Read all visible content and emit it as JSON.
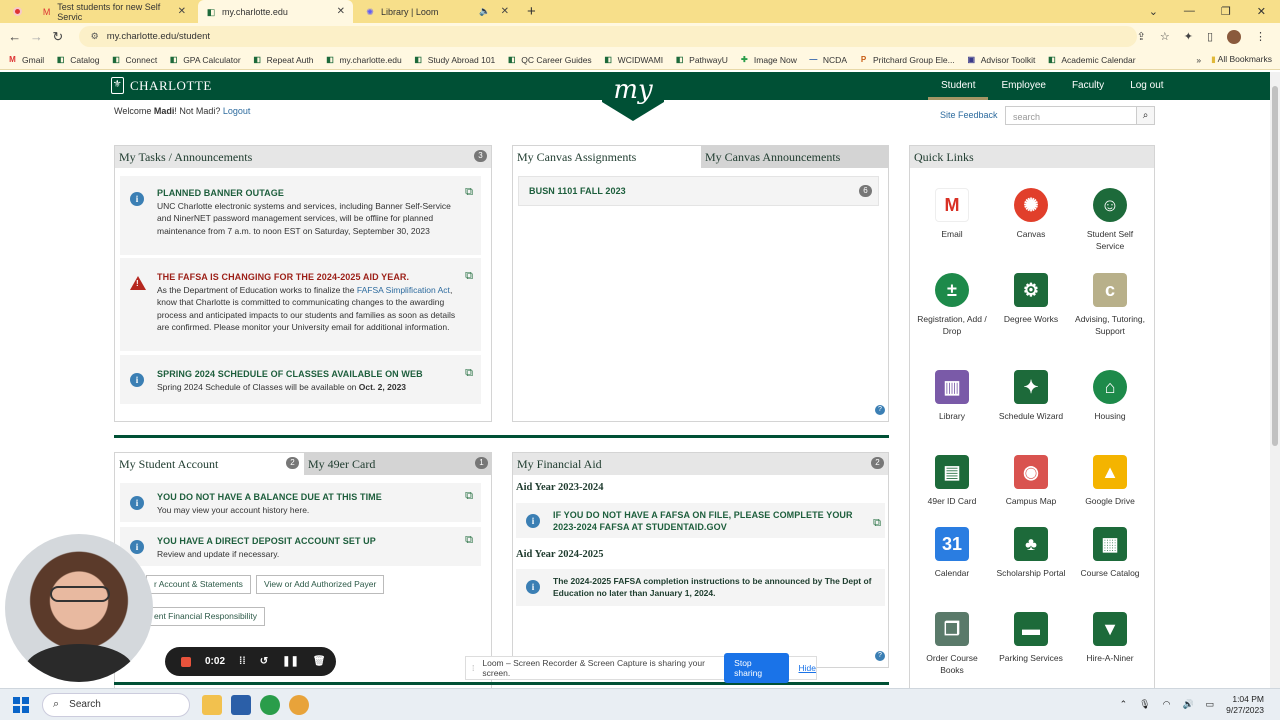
{
  "browser": {
    "tabs": [
      {
        "title": "Test students for new Self Servic",
        "active": false
      },
      {
        "title": "my.charlotte.edu",
        "active": true
      },
      {
        "title": "Library | Loom",
        "active": false
      }
    ],
    "url": "my.charlotte.edu/student",
    "bookmarks": [
      "Gmail",
      "Catalog",
      "Connect",
      "GPA Calculator",
      "Repeat Auth",
      "my.charlotte.edu",
      "Study Abroad 101",
      "QC Career Guides",
      "WCIDWAMI",
      "PathwayU",
      "Image Now",
      "NCDA",
      "Pritchard Group Ele...",
      "Advisor Toolkit",
      "Academic Calendar"
    ],
    "all_bookmarks": "All Bookmarks"
  },
  "header": {
    "logo_text": "CHARLOTTE",
    "badge_text": "my",
    "nav": [
      "Student",
      "Employee",
      "Faculty",
      "Log out"
    ]
  },
  "welcome": {
    "prefix": "Welcome ",
    "name": "Madi",
    "middle": "! Not Madi? ",
    "logout": "Logout"
  },
  "site_feedback": "Site Feedback",
  "search_placeholder": "search",
  "tasks": {
    "title": "My Tasks / Announcements",
    "count": "3",
    "items": [
      {
        "title": "PLANNED BANNER OUTAGE",
        "body": "UNC Charlotte electronic systems and services, including Banner Self-Service and NinerNET password management services, will be offline for planned maintenance from 7 a.m. to noon EST on Saturday, September 30, 2023"
      },
      {
        "title": "THE FAFSA IS CHANGING FOR THE 2024-2025 AID YEAR.",
        "body_a": "As the Department of Education works to finalize the ",
        "body_link": "FAFSA Simplification Act",
        "body_b": ", know that Charlotte is committed to communicating changes to the awarding process and anticipated impacts to our students and families as soon as details are confirmed. Please monitor your University email for additional information."
      },
      {
        "title": "SPRING 2024 SCHEDULE OF CLASSES AVAILABLE ON WEB",
        "body_a": "Spring 2024 Schedule of Classes will be available on ",
        "body_bold": "Oct. 2, 2023"
      }
    ]
  },
  "canvas": {
    "tab1": "My Canvas Assignments",
    "tab2": "My Canvas Announcements",
    "course": "BUSN 1101 FALL 2023",
    "course_count": "6"
  },
  "student_account": {
    "tab1": "My Student Account",
    "count1": "2",
    "tab2": "My 49er Card",
    "count2": "1",
    "items": [
      {
        "title": "YOU DO NOT HAVE A BALANCE DUE AT THIS TIME",
        "body": "You may view your account history here."
      },
      {
        "title": "YOU HAVE A DIRECT DEPOSIT ACCOUNT SET UP",
        "body": "Review and update if necessary."
      }
    ],
    "btn1": "r Account & Statements",
    "btn2": "View or Add Authorized Payer",
    "btn3": "ent Financial Responsibility"
  },
  "financial_aid": {
    "title": "My Financial Aid",
    "count": "2",
    "year1": "Aid Year 2023-2024",
    "item1": "IF YOU DO NOT HAVE A FAFSA ON FILE, PLEASE COMPLETE YOUR 2023-2024 FAFSA AT STUDENTAID.GOV",
    "year2": "Aid Year 2024-2025",
    "item2": "The 2024-2025 FAFSA completion instructions to be announced by The Dept of Education no later than January 1, 2024."
  },
  "quick_links": {
    "title": "Quick Links",
    "links": [
      {
        "label": "Email",
        "icon": "gmail-icon",
        "color": "#ffffff"
      },
      {
        "label": "Canvas",
        "icon": "canvas-icon",
        "color": "#e13f2b"
      },
      {
        "label": "Student Self Service",
        "icon": "self-service-icon",
        "color": "#1d6a3a"
      },
      {
        "label": "Registration, Add / Drop",
        "icon": "registration-icon",
        "color": "#1d8a4a"
      },
      {
        "label": "Degree Works",
        "icon": "gear-icon",
        "color": "#1d6a3a"
      },
      {
        "label": "Advising, Tutoring, Support",
        "icon": "connect-icon",
        "color": "#b8b08a"
      },
      {
        "label": "Library",
        "icon": "books-icon",
        "color": "#7a5aa8"
      },
      {
        "label": "Schedule Wizard",
        "icon": "wizard-icon",
        "color": "#1d6a3a"
      },
      {
        "label": "Housing",
        "icon": "housing-icon",
        "color": "#1d8a4a"
      },
      {
        "label": "49er ID Card",
        "icon": "id-card-icon",
        "color": "#1d6a3a"
      },
      {
        "label": "Campus Map",
        "icon": "map-icon",
        "color": "#d9534f"
      },
      {
        "label": "Google Drive",
        "icon": "drive-icon",
        "color": "#f4b400"
      },
      {
        "label": "Calendar",
        "icon": "calendar-icon",
        "color": "#2a7de1"
      },
      {
        "label": "Scholarship Portal",
        "icon": "tree-icon",
        "color": "#1d6a3a"
      },
      {
        "label": "Course Catalog",
        "icon": "catalog-icon",
        "color": "#1d6a3a"
      },
      {
        "label": "Order Course Books",
        "icon": "books-order-icon",
        "color": "#5a7a6a"
      },
      {
        "label": "Parking Services",
        "icon": "car-icon",
        "color": "#1d6a3a"
      },
      {
        "label": "Hire-A-Niner",
        "icon": "tie-icon",
        "color": "#1d6a3a"
      }
    ]
  },
  "recording": {
    "time": "0:02"
  },
  "share_bar": {
    "text": "Loom – Screen Recorder & Screen Capture is sharing your screen.",
    "stop": "Stop sharing",
    "hide": "Hide"
  },
  "taskbar": {
    "search": "Search",
    "time": "1:04 PM",
    "date": "9/27/2023"
  }
}
